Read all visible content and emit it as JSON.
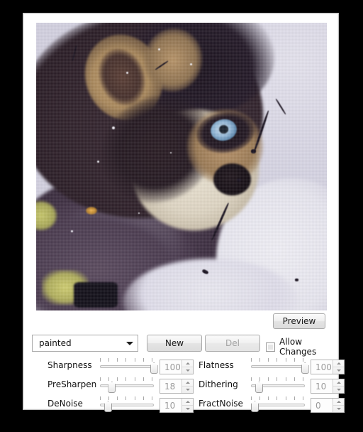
{
  "dialog": {
    "preview_button": "Preview",
    "preset": {
      "selected": "painted",
      "new_label": "New",
      "del_label": "Del"
    },
    "allow_changes": {
      "label": "Allow Changes",
      "checked": false
    },
    "sliders": [
      {
        "label": "Sharpness",
        "value": "100",
        "percent": 100
      },
      {
        "label": "Flatness",
        "value": "100",
        "percent": 100
      },
      {
        "label": "PreSharpen",
        "value": "18",
        "percent": 18
      },
      {
        "label": "Dithering",
        "value": "10",
        "percent": 10
      },
      {
        "label": "DeNoise",
        "value": "10",
        "percent": 10
      },
      {
        "label": "FractNoise",
        "value": "0",
        "percent": 0
      }
    ]
  },
  "image": {
    "subject": "painterly-filtered photo of a husky dog in snow",
    "colors": {
      "snow": "#dcdae8",
      "fur_dark": "#2a1d26",
      "fur_tan": "#b8936b",
      "eye_blue": "#8fb4d4",
      "olive": "#c8c86d"
    }
  }
}
